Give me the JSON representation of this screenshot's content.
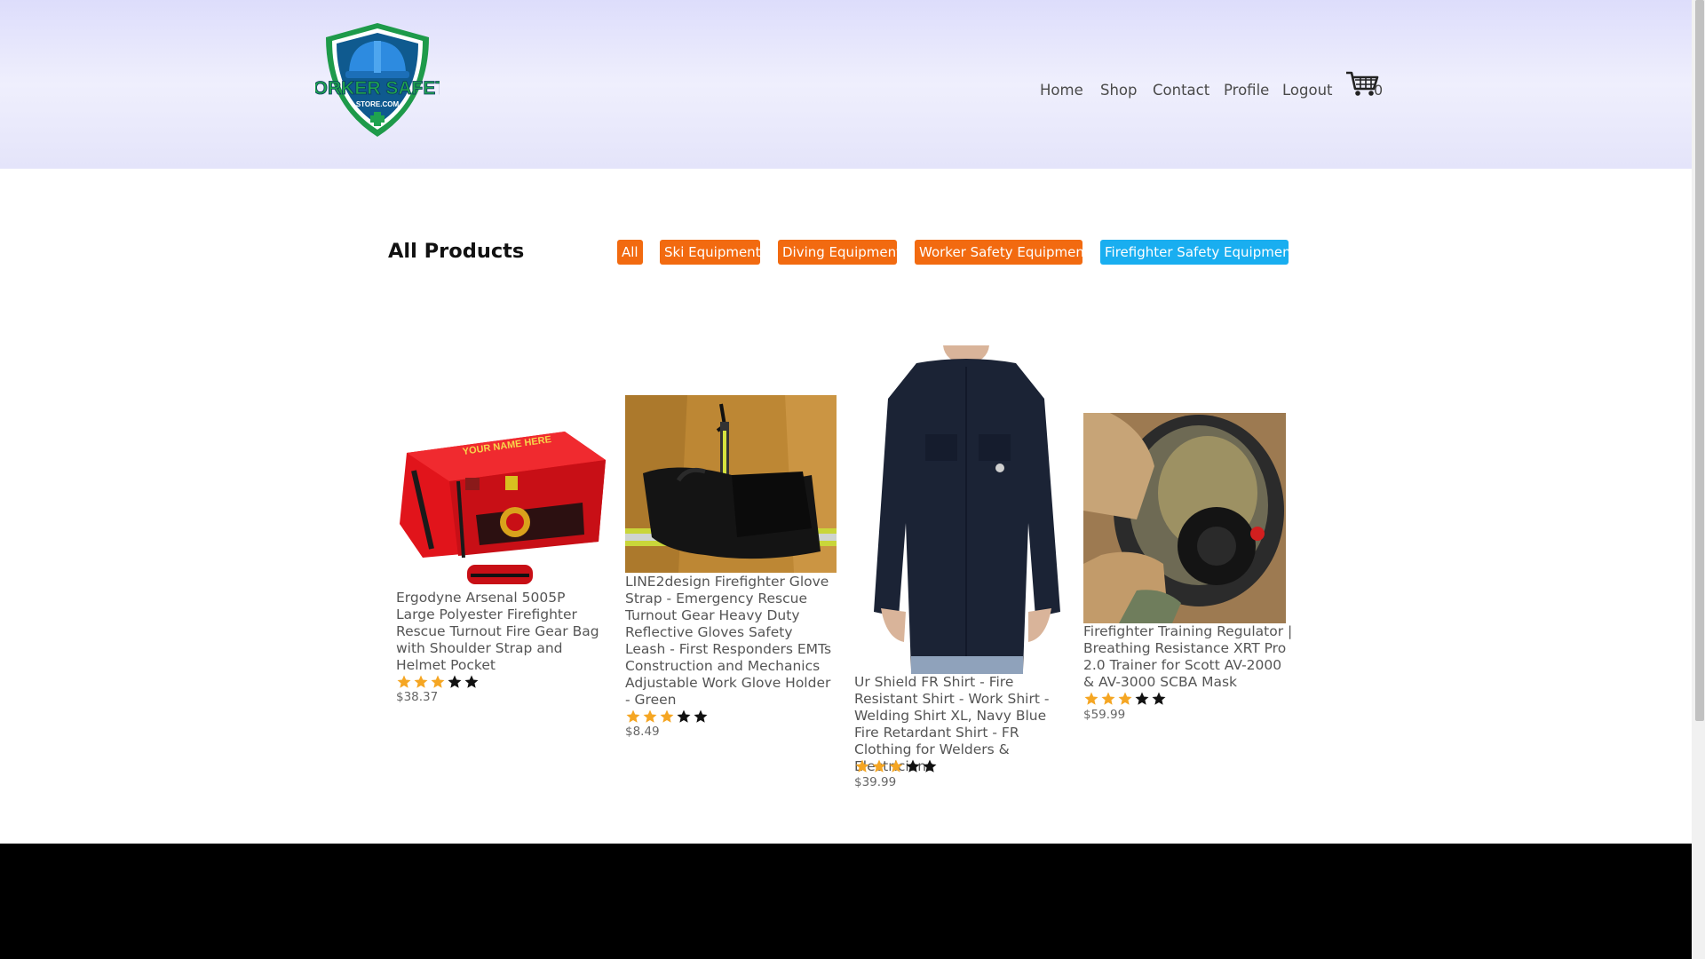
{
  "header": {
    "logo": {
      "line1": "WORKER SAFETY",
      "line2": "STORE.COM"
    },
    "nav": [
      "Home",
      "Shop",
      "Contact",
      "Profile",
      "Logout"
    ],
    "cart_icon": "cart-icon",
    "cart_count": "0"
  },
  "main": {
    "title": "All Products",
    "filters": [
      {
        "label": "All",
        "active": false
      },
      {
        "label": "Ski Equipment",
        "active": false
      },
      {
        "label": "Diving Equipment",
        "active": false
      },
      {
        "label": "Worker Safety Equipment",
        "active": false
      },
      {
        "label": "Firefighter Safety Equipment",
        "active": true
      }
    ],
    "products": [
      {
        "title": "Ergodyne Arsenal 5005P Large Polyester Firefighter Rescue Turnout Fire Gear Bag with Shoulder Strap and Helmet Pocket",
        "image_text": "YOUR NAME HERE",
        "rating": 3,
        "max_rating": 5,
        "price": "$38.37"
      },
      {
        "title": "LINE2design Firefighter Glove Strap - Emergency Rescue Turnout Gear Heavy Duty Reflective Gloves Safety Leash - First Responders EMTs Construction and Mechanics Adjustable Work Glove Holder - Green",
        "rating": 3,
        "max_rating": 5,
        "price": "$8.49"
      },
      {
        "title": "Ur Shield FR Shirt - Fire Resistant Shirt - Work Shirt - Welding Shirt XL, Navy Blue Fire Retardant Shirt - FR Clothing for Welders & Electricians",
        "rating": 3,
        "max_rating": 5,
        "price": "$39.99"
      },
      {
        "title": "Firefighter Training Regulator | Breathing Resistance XRT Pro 2.0 Trainer for Scott AV-2000 & AV-3000 SCBA Mask",
        "rating": 3,
        "max_rating": 5,
        "price": "$59.99"
      }
    ]
  },
  "colors": {
    "filter_orange": "#f26a10",
    "filter_active_blue": "#19aef0",
    "star_filled": "#f5a623",
    "star_empty": "#111111"
  }
}
